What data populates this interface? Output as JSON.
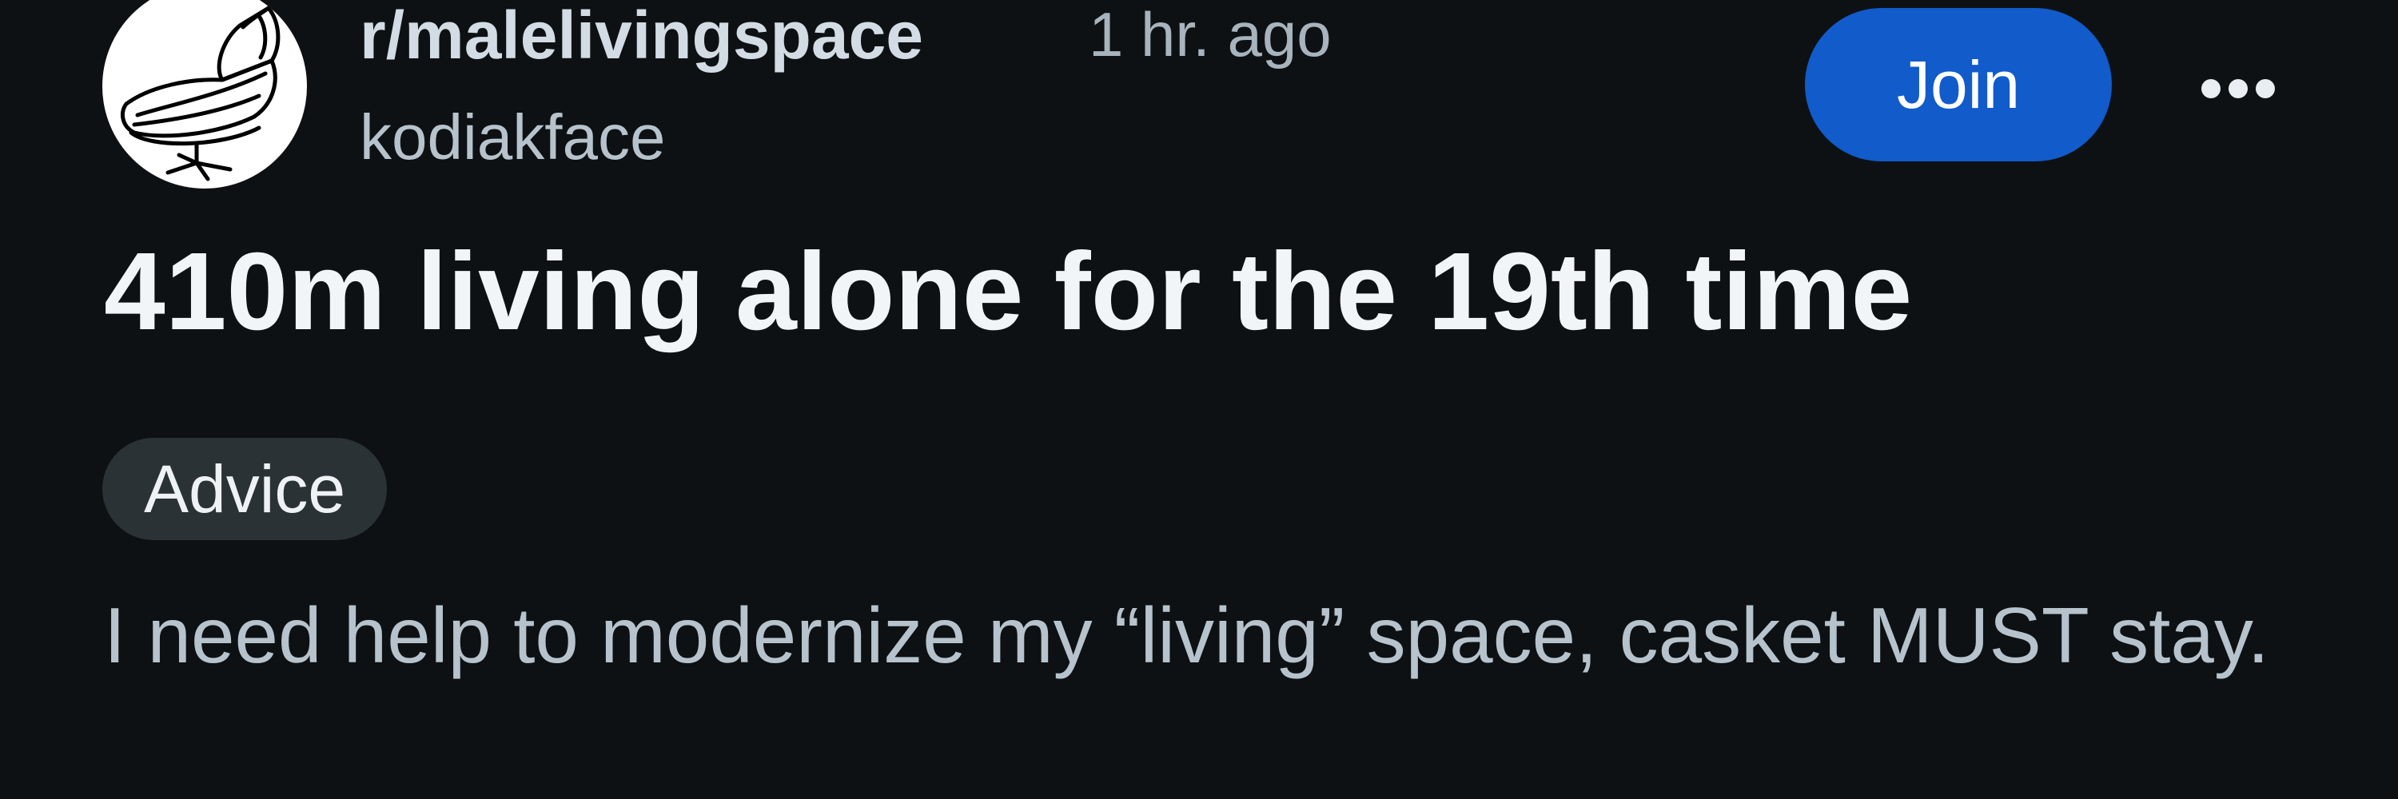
{
  "post": {
    "subreddit": "r/malelivingspace",
    "time_ago": "1 hr. ago",
    "author": "kodiakface",
    "title": "410m living alone for the 19th time",
    "flair": "Advice",
    "body": "I need help to modernize my “living” space, casket MUST stay."
  },
  "actions": {
    "join_label": "Join",
    "more_icon": "ellipsis-icon"
  },
  "avatar": {
    "icon": "lounge-chair-icon"
  },
  "colors": {
    "background": "#0e1113",
    "join_button": "#115bca",
    "flair_background": "#2a3236",
    "title_text": "#f2f5f7",
    "secondary_text": "#b7c3cc"
  }
}
